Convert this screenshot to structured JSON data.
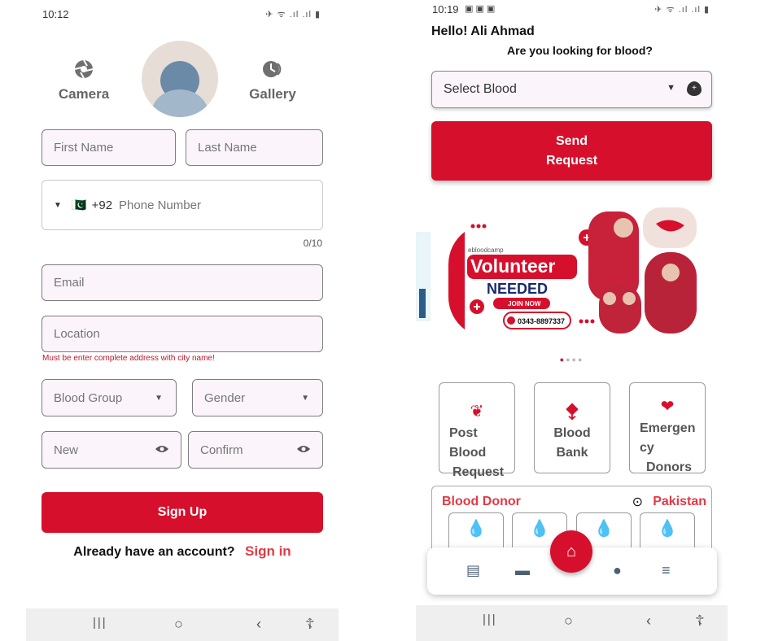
{
  "left": {
    "status": {
      "time": "10:12",
      "icons": "✈ ᯤ .ıl .ıl ▮"
    },
    "camera_label": "Camera",
    "gallery_label": "Gallery",
    "first_name_placeholder": "First Name",
    "last_name_placeholder": "Last Name",
    "phone": {
      "flag": "🇵🇰",
      "code": "+92",
      "placeholder": "Phone Number",
      "counter": "0/10"
    },
    "email_placeholder": "Email",
    "location_placeholder": "Location",
    "location_helper": "Must be enter complete address with city name!",
    "blood_group_label": "Blood Group",
    "gender_label": "Gender",
    "new_password_placeholder": "New",
    "confirm_password_placeholder": "Confirm",
    "signup_label": "Sign Up",
    "already_account": "Already have an account?",
    "signin_link": "Sign in"
  },
  "right": {
    "status": {
      "time": "10:19",
      "icons": "✈ ᯤ .ıl .ıl ▮"
    },
    "greeting": "Hello!  Ali Ahmad",
    "question": "Are you looking for blood?",
    "select_blood": "Select Blood",
    "send_request_line1": "Send",
    "send_request_line2": "Request",
    "banner": {
      "brand": "ebloodcamp",
      "headline": "Volunteer",
      "subhead": "NEEDED",
      "cta": "JOIN NOW",
      "phone": "0343-8897337"
    },
    "cards": [
      {
        "line1": "Post",
        "line2": "Blood",
        "line3": "Request"
      },
      {
        "line1": "Blood",
        "line2": "Bank"
      },
      {
        "line1": "Emergen",
        "line2": "cy",
        "line3": "Donors"
      }
    ],
    "donor_title": "Blood Donor",
    "donor_country": "Pakistan"
  },
  "colors": {
    "primary": "#d6102c",
    "accent_text": "#e23a45",
    "field_bg": "#fbf5fb"
  }
}
